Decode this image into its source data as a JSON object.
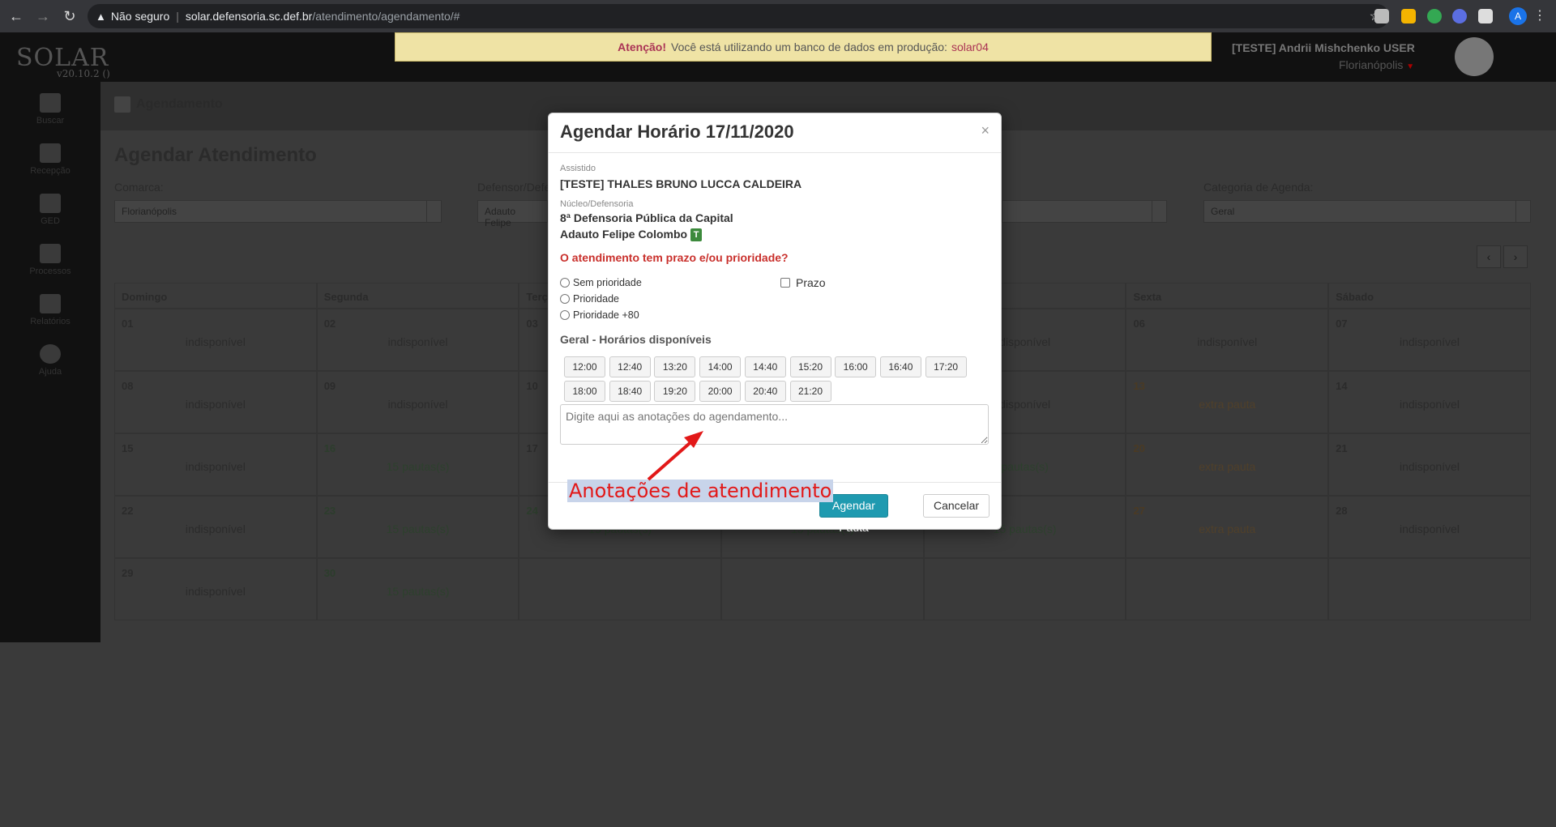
{
  "browser": {
    "security_label": "Não seguro",
    "url_host": "solar.defensoria.sc.def.br",
    "url_path": "/atendimento/agendamento/#",
    "profile_initial": "A",
    "ext_badge": "2"
  },
  "app": {
    "logo": "SOLAR",
    "version": "v20.10.2 ()",
    "alert": {
      "prefix": "Atenção!",
      "text": "Você está utilizando um banco de dados em produção:",
      "db": "solar04"
    },
    "user": {
      "name": "[TESTE] Andrii Mishchenko USER",
      "location": "Florianópolis"
    }
  },
  "sidebar": {
    "items": [
      {
        "label": "Buscar",
        "icon": "search-icon"
      },
      {
        "label": "Recepção",
        "icon": "book-icon"
      },
      {
        "label": "GED",
        "icon": "edit-document-icon"
      },
      {
        "label": "Processos",
        "icon": "folder-icon"
      },
      {
        "label": "Relatórios",
        "icon": "bar-chart-icon"
      },
      {
        "label": "Ajuda",
        "icon": "help-icon"
      }
    ]
  },
  "page": {
    "header": "Agendamento",
    "title": "Agendar Atendimento",
    "filters": {
      "comarca_label": "Comarca:",
      "comarca_value": "Florianópolis",
      "defensor_label": "Defensor/Defe",
      "defensor_value": "Adauto Felipe",
      "categoria_label": "Categoria de Agenda:",
      "categoria_value": "Geral"
    }
  },
  "calendar": {
    "headers": [
      "Domingo",
      "Segunda",
      "Terça",
      "",
      "",
      "Sexta",
      "Sábado"
    ],
    "rows": [
      [
        {
          "day": "01",
          "status": "indisponível"
        },
        {
          "day": "02",
          "status": "indisponível"
        },
        {
          "day": "03",
          "status": ""
        },
        {
          "day": "",
          "status": ""
        },
        {
          "day": "",
          "status": "disponível"
        },
        {
          "day": "06",
          "status": "indisponível"
        },
        {
          "day": "07",
          "status": "indisponível"
        }
      ],
      [
        {
          "day": "08",
          "status": "indisponível"
        },
        {
          "day": "09",
          "status": "indisponível"
        },
        {
          "day": "10",
          "status": ""
        },
        {
          "day": "",
          "status": ""
        },
        {
          "day": "",
          "status": "disponível"
        },
        {
          "day": "13",
          "status": "extra pauta",
          "tone": "orange"
        },
        {
          "day": "14",
          "status": "indisponível"
        }
      ],
      [
        {
          "day": "15",
          "status": "indisponível"
        },
        {
          "day": "16",
          "status": "15 pautas(s)",
          "tone": "green"
        },
        {
          "day": "17",
          "status": ""
        },
        {
          "day": "",
          "status": ""
        },
        {
          "day": "",
          "status": "pautas(s)",
          "tone": "green"
        },
        {
          "day": "20",
          "status": "extra pauta",
          "tone": "orange"
        },
        {
          "day": "21",
          "status": "indisponível"
        }
      ],
      [
        {
          "day": "22",
          "status": "indisponível"
        },
        {
          "day": "23",
          "status": "15 pautas(s)",
          "tone": "green"
        },
        {
          "day": "24",
          "status": "15 pautas(s)",
          "tone": "green"
        },
        {
          "day": "",
          "status": "15 pautas(s)",
          "tone": "green"
        },
        {
          "day": "",
          "status": "15 pautas(s)",
          "tone": "green"
        },
        {
          "day": "27",
          "status": "extra pauta",
          "tone": "orange"
        },
        {
          "day": "28",
          "status": "indisponível"
        }
      ],
      [
        {
          "day": "29",
          "status": "indisponível"
        },
        {
          "day": "30",
          "status": "15 pautas(s)",
          "tone": "green"
        },
        {
          "day": "",
          "status": ""
        },
        {
          "day": "",
          "status": ""
        },
        {
          "day": "",
          "status": ""
        },
        {
          "day": "",
          "status": ""
        },
        {
          "day": "",
          "status": ""
        }
      ]
    ]
  },
  "modal": {
    "title": "Agendar Horário 17/11/2020",
    "close": "×",
    "assistido_label": "Assistido",
    "assistido": "[TESTE] THALES BRUNO LUCCA CALDEIRA",
    "nucleo_label": "Núcleo/Defensoria",
    "nucleo": "8ª Defensoria Pública da Capital",
    "defensor": "Adauto Felipe Colombo",
    "defensor_badge": "T",
    "question": "O atendimento tem prazo e/ou prioridade?",
    "radios": [
      "Sem prioridade",
      "Prioridade",
      "Prioridade +80"
    ],
    "prazo_label": "Prazo",
    "slots_title": "Geral - Horários disponíveis",
    "slots": [
      "12:00",
      "12:40",
      "13:20",
      "14:00",
      "14:40",
      "15:20",
      "16:00",
      "16:40",
      "17:20",
      "18:00",
      "18:40",
      "19:20",
      "20:00",
      "20:40",
      "21:20"
    ],
    "notes_placeholder": "Digite aqui as anotações do agendamento...",
    "submit": "Agendar Pauta",
    "cancel": "Cancelar"
  },
  "annotation": {
    "text": "Anotações de atendimento",
    "color": "#e21818"
  }
}
